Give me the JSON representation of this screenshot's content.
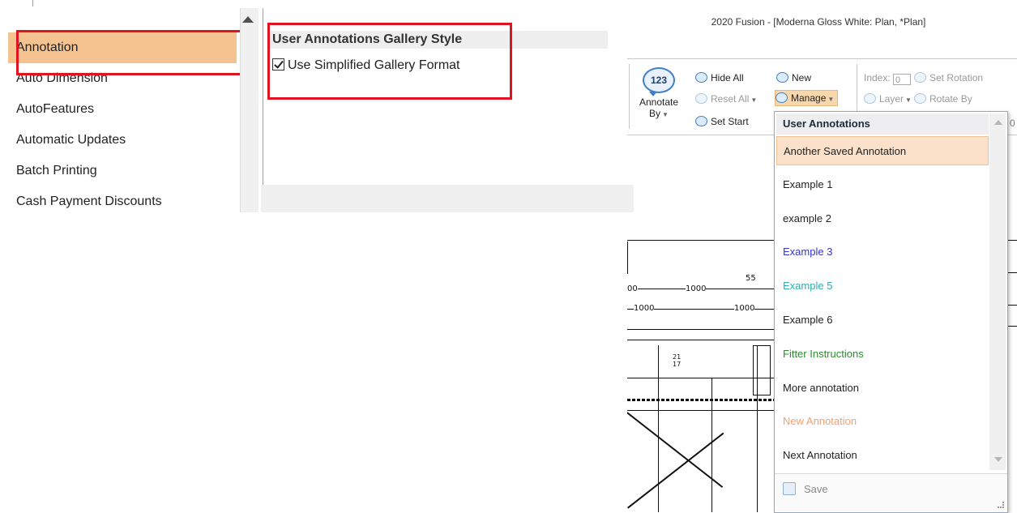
{
  "options_dialog": {
    "categories": [
      {
        "label": "Annotation",
        "selected": true
      },
      {
        "label": "Auto Dimension",
        "selected": false
      },
      {
        "label": "AutoFeatures",
        "selected": false
      },
      {
        "label": "Automatic Updates",
        "selected": false
      },
      {
        "label": "Batch Printing",
        "selected": false
      },
      {
        "label": "Cash Payment Discounts",
        "selected": false
      }
    ],
    "section_header": "User Annotations Gallery Style",
    "checkbox_label": "Use Simplified Gallery Format",
    "checkbox_checked": true,
    "highlight_color": "#e0141e",
    "selected_color": "#f5c38f"
  },
  "window": {
    "title": "2020 Fusion - [Moderna Gloss White: Plan, *Plan]"
  },
  "ribbon": {
    "annotate_by": {
      "badge": "123",
      "label_line1": "Annotate",
      "label_line2": "By"
    },
    "hide_all": "Hide All",
    "reset_all": "Reset All",
    "set_start": "Set Start",
    "new": "New",
    "manage": "Manage",
    "index_label": "Index:",
    "index_value": "0",
    "set_rotation": "Set Rotation",
    "layer": "Layer",
    "rotate_by": "Rotate By",
    "cut_text": "0"
  },
  "drawing": {
    "dims": [
      "55",
      "1000",
      "1000",
      "1000",
      "00",
      "21",
      "17"
    ]
  },
  "manage_menu": {
    "header": "User Annotations",
    "items": [
      {
        "label": "Another Saved Annotation",
        "color": "#222222",
        "highlighted": true
      },
      {
        "label": "Example 1",
        "color": "#222222",
        "highlighted": false
      },
      {
        "label": "example 2",
        "color": "#222222",
        "highlighted": false
      },
      {
        "label": "Example 3",
        "color": "#3535d6",
        "highlighted": false
      },
      {
        "label": "Example 5",
        "color": "#2bb0b0",
        "highlighted": false
      },
      {
        "label": "Example 6",
        "color": "#222222",
        "highlighted": false
      },
      {
        "label": "Fitter Instructions",
        "color": "#2e8b2e",
        "highlighted": false
      },
      {
        "label": "More annotation",
        "color": "#222222",
        "highlighted": false
      },
      {
        "label": "New Annotation",
        "color": "#f2a072",
        "highlighted": false
      },
      {
        "label": "Next Annotation",
        "color": "#222222",
        "highlighted": false
      }
    ],
    "save_label": "Save"
  }
}
